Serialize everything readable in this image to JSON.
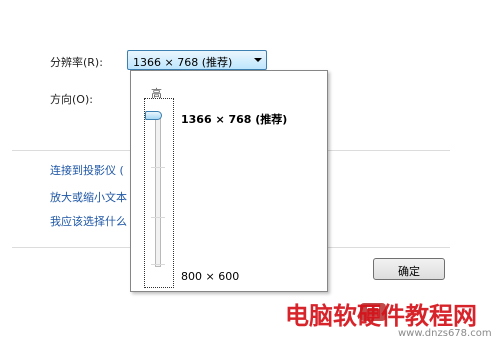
{
  "settings": {
    "resolution_label": "分辨率(R):",
    "resolution_value": "1366 × 768 (推荐)",
    "orientation_label": "方向(O):"
  },
  "dropdown": {
    "high_label": "高",
    "selected_option": "1366 × 768 (推荐)",
    "lowest_option": "800 × 600",
    "thumb_position_fraction": 1.0
  },
  "links": [
    "连接到投影仪 (",
    "放大或缩小文本",
    "我应该选择什么"
  ],
  "buttons": {
    "ok_label": "确定"
  },
  "watermark": {
    "text": "电脑软硬件教程网",
    "url": "www.dnzs678.com"
  },
  "colors": {
    "link": "#1f57a6",
    "combo_border": "#3c7fb1",
    "watermark": "#d4121a"
  }
}
